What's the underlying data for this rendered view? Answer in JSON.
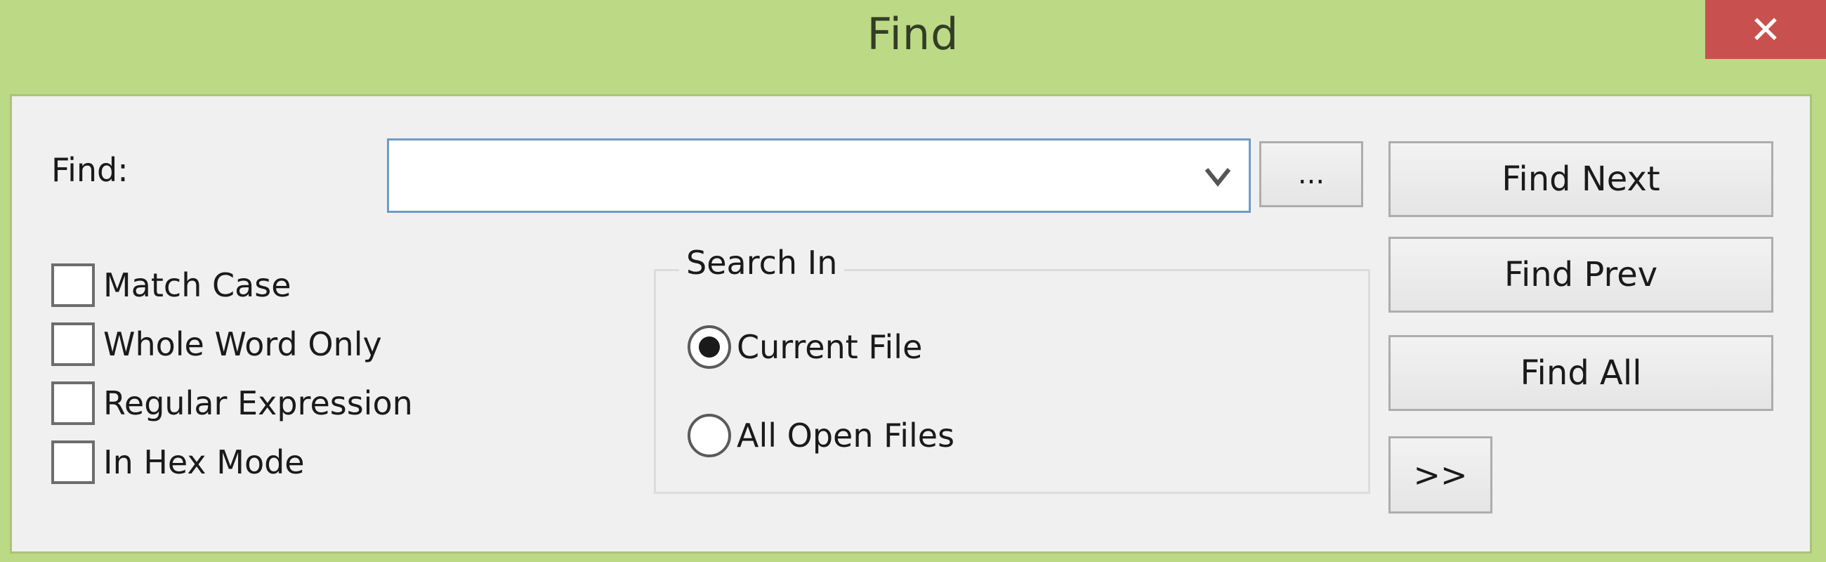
{
  "window": {
    "title": "Find",
    "close_glyph": "✕",
    "colors": {
      "titlebar": "#bcd986",
      "close_button": "#c8514f",
      "client_bg": "#f0f0f0",
      "focus_border": "#6f9bc6"
    }
  },
  "find": {
    "label": "Find:",
    "value": "",
    "placeholder": "",
    "dropdown_icon": "chevron-down-icon",
    "browse_label": "..."
  },
  "options": {
    "checkboxes": [
      {
        "label": "Match Case",
        "checked": false
      },
      {
        "label": "Whole Word Only",
        "checked": false
      },
      {
        "label": "Regular Expression",
        "checked": false
      },
      {
        "label": "In Hex Mode",
        "checked": false
      }
    ]
  },
  "search_in": {
    "title": "Search In",
    "options": [
      {
        "label": "Current File",
        "selected": true
      },
      {
        "label": "All Open Files",
        "selected": false
      }
    ]
  },
  "buttons": {
    "find_next": "Find Next",
    "find_prev": "Find Prev",
    "find_all": "Find All",
    "more": ">>"
  }
}
